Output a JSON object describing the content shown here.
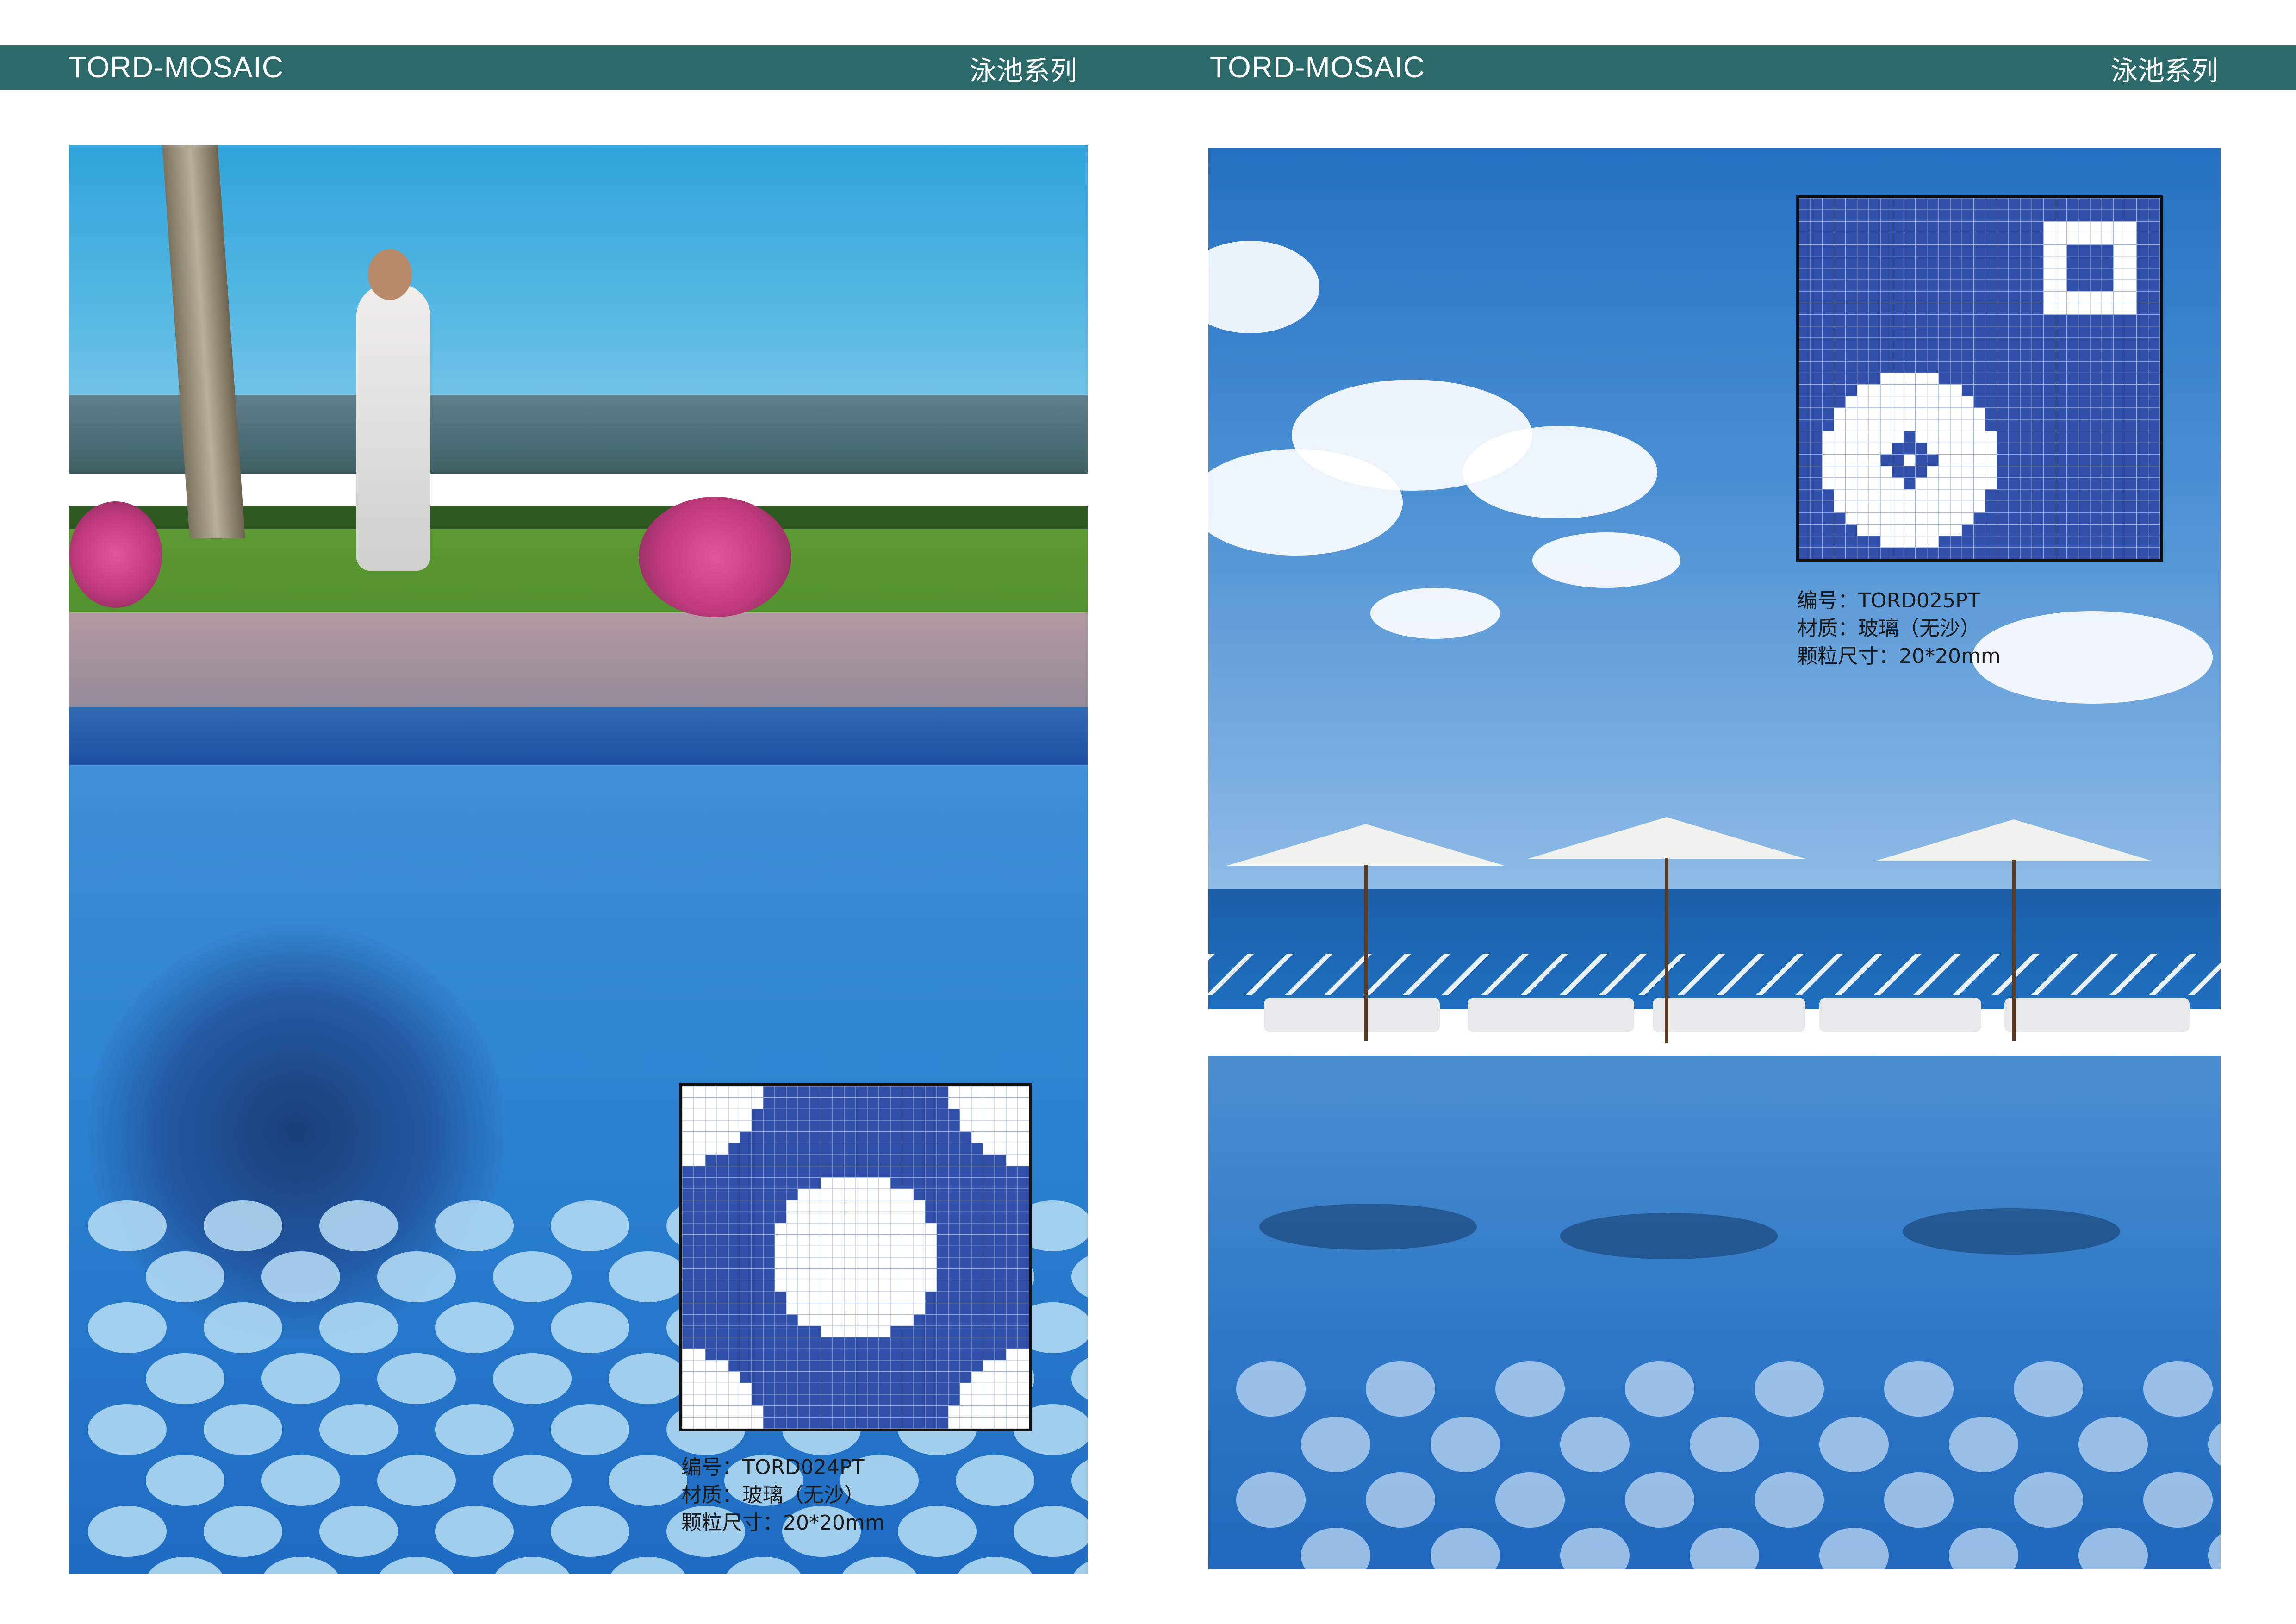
{
  "pages": [
    {
      "brand": "TORD-MOSAIC",
      "series": "泳池系列",
      "product": {
        "code_line": "编号：TORD024PT",
        "material_line": "材质：玻璃（无沙）",
        "size_line": "颗粒尺寸：20*20mm"
      }
    },
    {
      "brand": "TORD-MOSAIC",
      "series": "泳池系列",
      "product": {
        "code_line": "编号：TORD025PT",
        "material_line": "材质：玻璃（无沙）",
        "size_line": "颗粒尺寸：20*20mm"
      }
    }
  ],
  "colors": {
    "header_bar": "#2c6a6a",
    "tile_blue": "#2f4fa8",
    "tile_white": "#ffffff"
  }
}
